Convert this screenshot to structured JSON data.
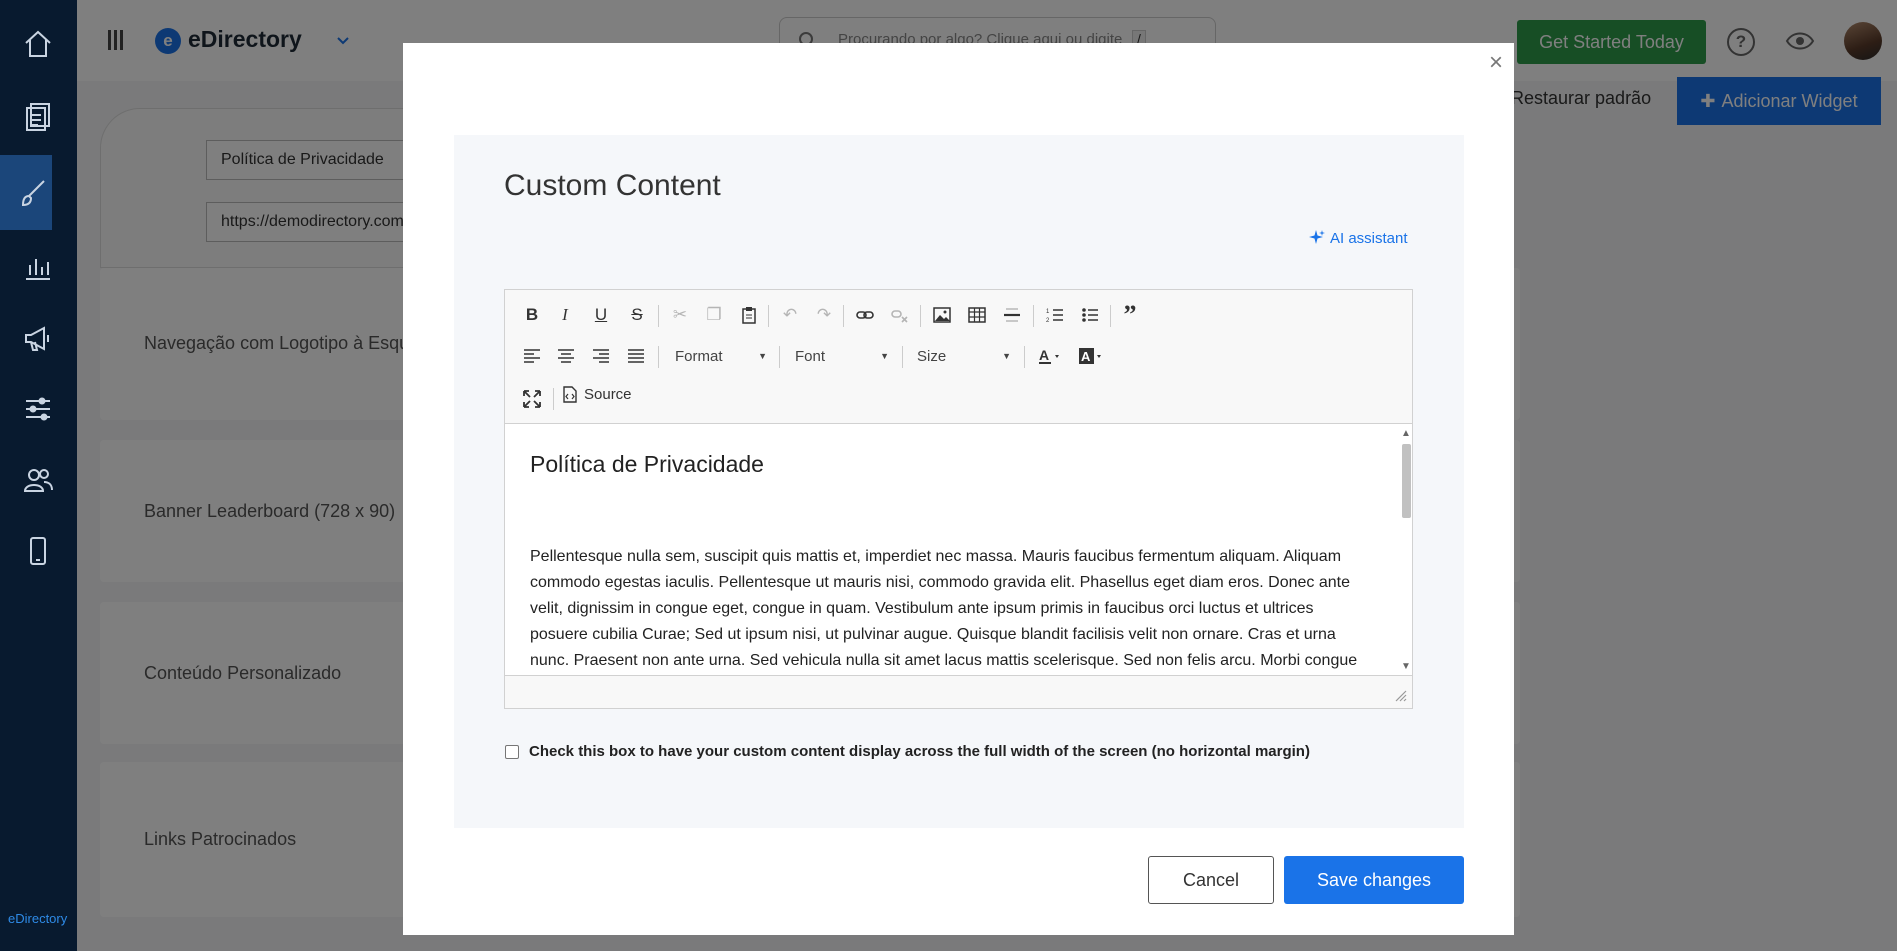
{
  "app": {
    "brand": "eDirectory",
    "brand_logo_letter": "e",
    "sidebar_brand": "eDirectory",
    "search_placeholder": "Procurando por algo? Clique aqui ou digite",
    "search_shortcut": "/",
    "get_started": "Get Started Today",
    "help_glyph": "?",
    "restore_default": "Restaurar padrão",
    "add_widget": "Adicionar Widget",
    "sidebar_icons": [
      "home-icon",
      "pages-icon",
      "brush-icon",
      "chart-icon",
      "megaphone-icon",
      "sliders-icon",
      "users-icon",
      "mobile-icon"
    ]
  },
  "page": {
    "page_name_value": "Política de Privacidade",
    "page_url_value": "https://demodirectory.com",
    "widgets": [
      "Navegação com Logotipo à Esquerda",
      "Banner Leaderboard (728 x 90)",
      "Conteúdo Personalizado",
      "Links Patrocinados"
    ]
  },
  "modal": {
    "close_glyph": "×",
    "title": "Custom Content",
    "ai_assistant": "AI assistant",
    "toolbar": {
      "format": "Format",
      "font": "Font",
      "size": "Size",
      "source": "Source"
    },
    "content": {
      "heading": "Política de Privacidade",
      "paragraph": "Pellentesque nulla sem, suscipit quis mattis et, imperdiet nec massa. Mauris faucibus fermentum aliquam. Aliquam commodo egestas iaculis. Pellentesque ut mauris nisi, commodo gravida elit. Phasellus eget diam eros. Donec ante velit, dignissim in congue eget, congue in quam. Vestibulum ante ipsum primis in faucibus orci luctus et ultrices posuere cubilia Curae; Sed ut ipsum nisi, ut pulvinar augue. Quisque blandit facilisis velit non ornare. Cras et urna nunc. Praesent non ante urna. Sed vehicula nulla sit amet lacus mattis scelerisque. Sed non felis arcu. Morbi congue"
    },
    "fullwidth_label": "Check this box to have your custom content display across the full width of the screen (no horizontal margin)",
    "cancel": "Cancel",
    "save": "Save changes"
  },
  "colors": {
    "primary": "#1a73e8",
    "success": "#2e9d4b",
    "sidebar": "#0f3057"
  }
}
